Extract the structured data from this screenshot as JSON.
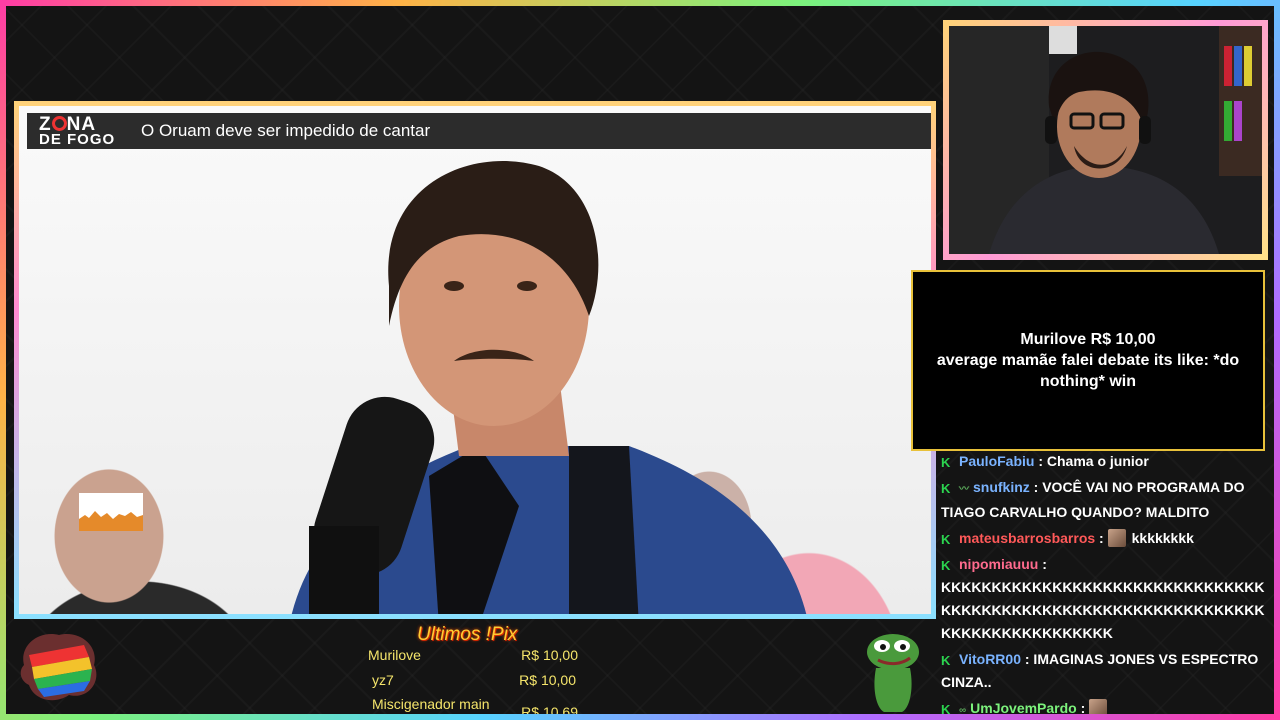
{
  "video": {
    "logo_line1_a": "Z",
    "logo_line1_b": "NA",
    "logo_line2": "DE FOGO",
    "title": "O Oruam deve ser impedido de cantar"
  },
  "alert": {
    "line1": "Murilove R$ 10,00",
    "line2": "average mamãe falei debate its like: *do nothing* win"
  },
  "chat": {
    "messages": [
      {
        "user": "PauloFabiu",
        "text": " : Chama o junior"
      },
      {
        "user": "snufkinz",
        "text": " : VOCÊ VAI NO PROGRAMA DO TIAGO CARVALHO QUANDO? MALDITO"
      },
      {
        "user": "mateusbarrosbarros",
        "text": " : ",
        "after_emote": "kkkkkkkk"
      },
      {
        "user": "nipomiauuu",
        "text": " : KKKKKKKKKKKKKKKKKKKKKKKKKKKKKKKKKKKKKKKKKKKKKKKKKKKKKKKKKKKKKKKKKKKKKKKKKKKKKKKKK"
      },
      {
        "user": "VitoRR00",
        "text": " : IMAGINAS JONES VS ESPECTRO CINZA.."
      },
      {
        "user": "UmJovemPardo",
        "text": " : "
      }
    ]
  },
  "pix": {
    "title": "Ultimos !Pix",
    "rows": [
      {
        "name": "Murilove",
        "amount": "R$ 10,00"
      },
      {
        "name": "yz7",
        "amount": "R$ 10,00"
      },
      {
        "name": "Miscigenador main",
        "amount": "R$ 10,69"
      }
    ]
  },
  "colors": {
    "chat_badge": "#2bd44f",
    "alert_border": "#e8c13a",
    "pix_text": "#f5e56b"
  }
}
